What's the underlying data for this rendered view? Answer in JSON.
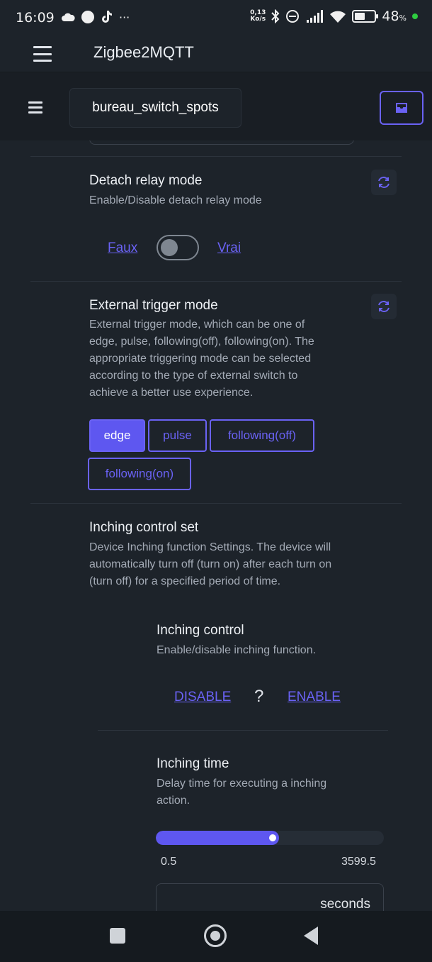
{
  "status_bar": {
    "time": "16:09",
    "net_speed_value": "0,13",
    "net_speed_unit": "Ko/s",
    "battery_pct": "48",
    "battery_suffix": "%",
    "more_label": "···"
  },
  "app_bar": {
    "title": "Zigbee2MQTT"
  },
  "device_bar": {
    "device_name": "bureau_switch_spots"
  },
  "detach_relay": {
    "title": "Detach relay mode",
    "description": "Enable/Disable detach relay mode",
    "false_label": "Faux",
    "true_label": "Vrai",
    "value": false
  },
  "external_trigger": {
    "title": "External trigger mode",
    "description_lines": [
      "External trigger mode, which can be one of",
      "edge, pulse, following(off), following(on). The",
      "appropriate triggering mode can be selected",
      "according to the type of external switch to",
      "achieve a better use experience."
    ],
    "options": [
      "edge",
      "pulse",
      "following(off)",
      "following(on)"
    ],
    "selected": "edge"
  },
  "inching_set": {
    "title": "Inching control set",
    "description_lines": [
      "Device Inching function Settings. The device will",
      "automatically turn off (turn on) after each turn on",
      "(turn off) for a specified period of time."
    ]
  },
  "inching_control": {
    "title": "Inching control",
    "description": "Enable/disable inching function.",
    "disable_label": "DISABLE",
    "unknown_label": "?",
    "enable_label": "ENABLE"
  },
  "inching_time": {
    "title": "Inching time",
    "description_lines": [
      "Delay time for executing a inching",
      "action."
    ],
    "min_label": "0.5",
    "max_label": "3599.5",
    "slider_fraction": 0.54,
    "unit": "seconds"
  },
  "colors": {
    "accent": "#5e57f0",
    "background": "#1d232a"
  }
}
